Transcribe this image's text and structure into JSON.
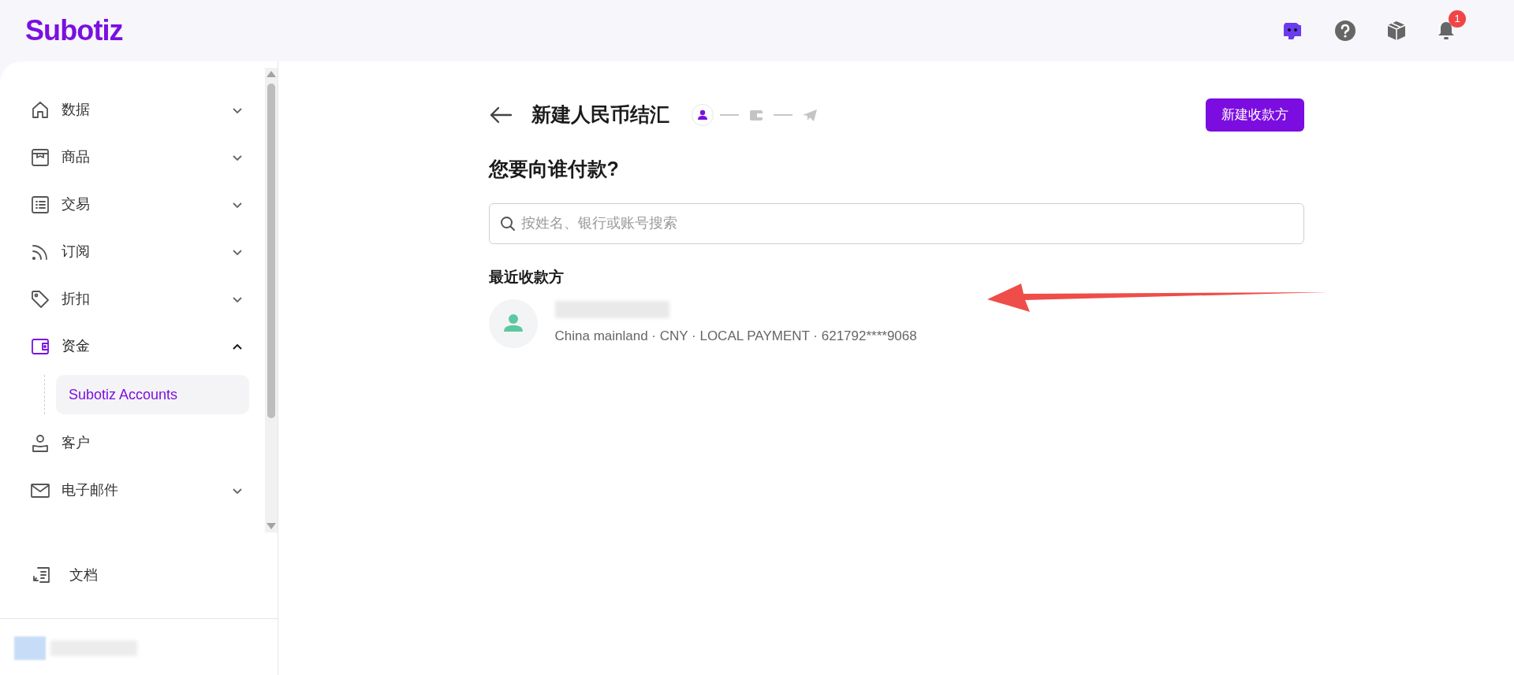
{
  "brand": {
    "logo": "Subotiz"
  },
  "topbar": {
    "actions": [
      {
        "kind": "bot"
      },
      {
        "kind": "help"
      },
      {
        "kind": "box"
      },
      {
        "kind": "bell",
        "badge": "1"
      }
    ]
  },
  "sidebar": {
    "items": [
      {
        "kind": "group",
        "label": "数据",
        "expanded": false,
        "selected": false
      },
      {
        "kind": "group",
        "label": "商品",
        "expanded": false,
        "selected": false
      },
      {
        "kind": "group",
        "label": "交易",
        "expanded": false,
        "selected": false
      },
      {
        "kind": "group",
        "label": "订阅",
        "expanded": false,
        "selected": false
      },
      {
        "kind": "group",
        "label": "折扣",
        "expanded": false,
        "selected": false
      },
      {
        "kind": "group",
        "label": "资金",
        "expanded": true,
        "selected": true,
        "children": [
          {
            "label": "Subotiz Accounts",
            "selected": true
          }
        ]
      },
      {
        "kind": "link",
        "label": "客户",
        "selected": false
      },
      {
        "kind": "group",
        "label": "电子邮件",
        "expanded": false,
        "selected": false
      }
    ],
    "footer_item": {
      "label": "文档"
    }
  },
  "page": {
    "title": "新建人民币结汇",
    "steps": [
      {
        "kind": "person",
        "selected": true
      },
      {
        "kind": "wallet",
        "selected": false
      },
      {
        "kind": "send",
        "selected": false
      }
    ],
    "new_button": "新建收款方",
    "question": "您要向谁付款?",
    "search": {
      "placeholder": "按姓名、银行或账号搜索"
    },
    "recent_heading": "最近收款方",
    "recipients": [
      {
        "details": "China mainland · CNY · LOCAL PAYMENT · 621792****9068"
      }
    ]
  }
}
